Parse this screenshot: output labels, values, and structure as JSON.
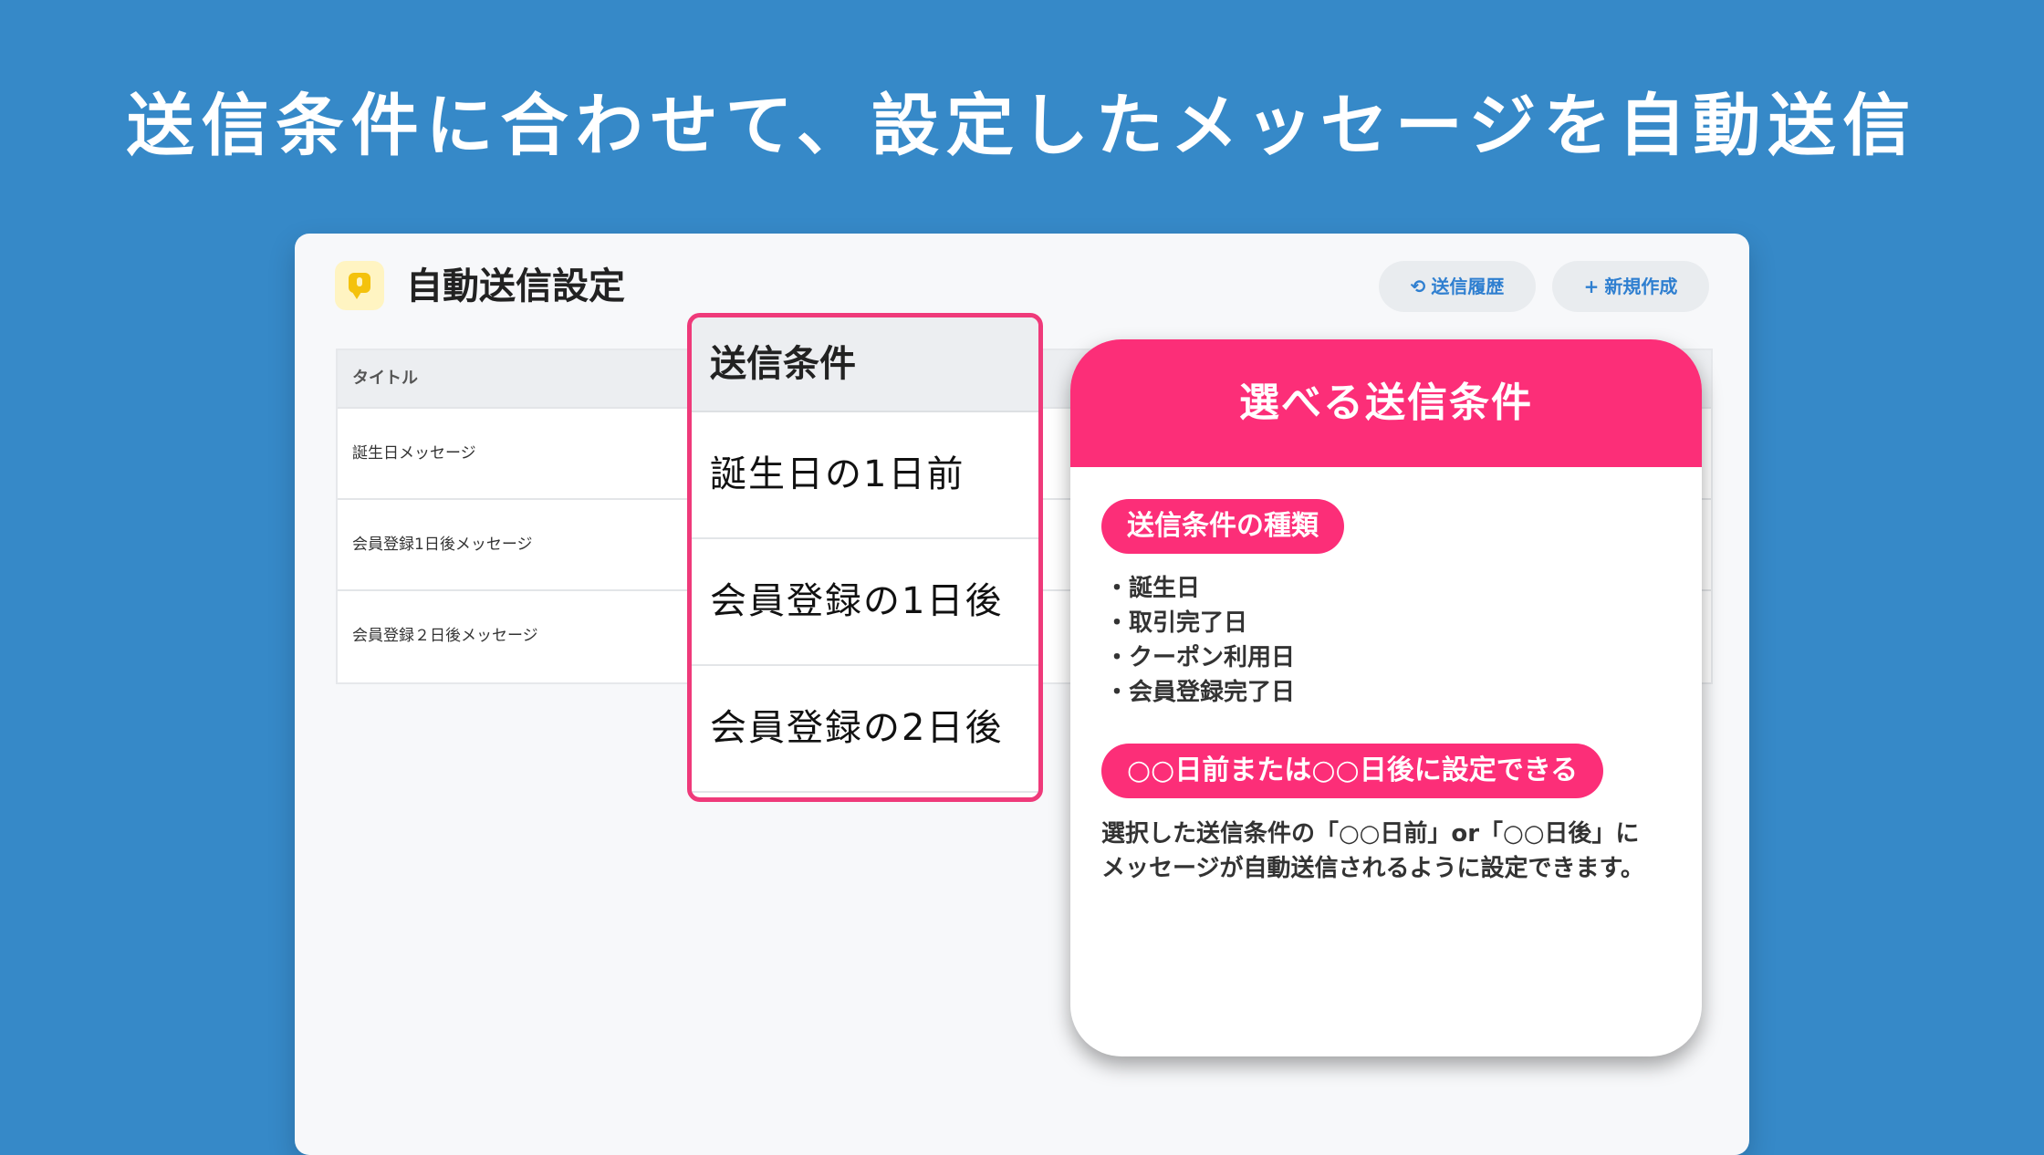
{
  "headline": "送信条件に合わせて、設定したメッセージを自動送信",
  "app": {
    "title": "自動送信設定",
    "history_button": "送信履歴",
    "new_button": "新規作成",
    "table": {
      "column_title": "タイトル",
      "rows": [
        "誕生日メッセージ",
        "会員登録1日後メッセージ",
        "会員登録２日後メッセージ"
      ]
    }
  },
  "condition_column": {
    "header": "送信条件",
    "rows": [
      "誕生日の1日前",
      "会員登録の1日後",
      "会員登録の2日後"
    ]
  },
  "callout": {
    "title": "選べる送信条件",
    "types_label": "送信条件の種類",
    "types": [
      "誕生日",
      "取引完了日",
      "クーポン利用日",
      "会員登録完了日"
    ],
    "days_label": "○○日前または○○日後に設定できる",
    "description_line1": "選択した送信条件の「○○日前」or「○○日後」に",
    "description_line2": "メッセージが自動送信されるように設定できます。"
  },
  "colors": {
    "background": "#3689c8",
    "accent_pink": "#fc2e78",
    "link_blue": "#2f7fd0"
  },
  "icons": {
    "app": "chat-bubble-icon",
    "history": "history-icon",
    "new": "plus-icon"
  }
}
